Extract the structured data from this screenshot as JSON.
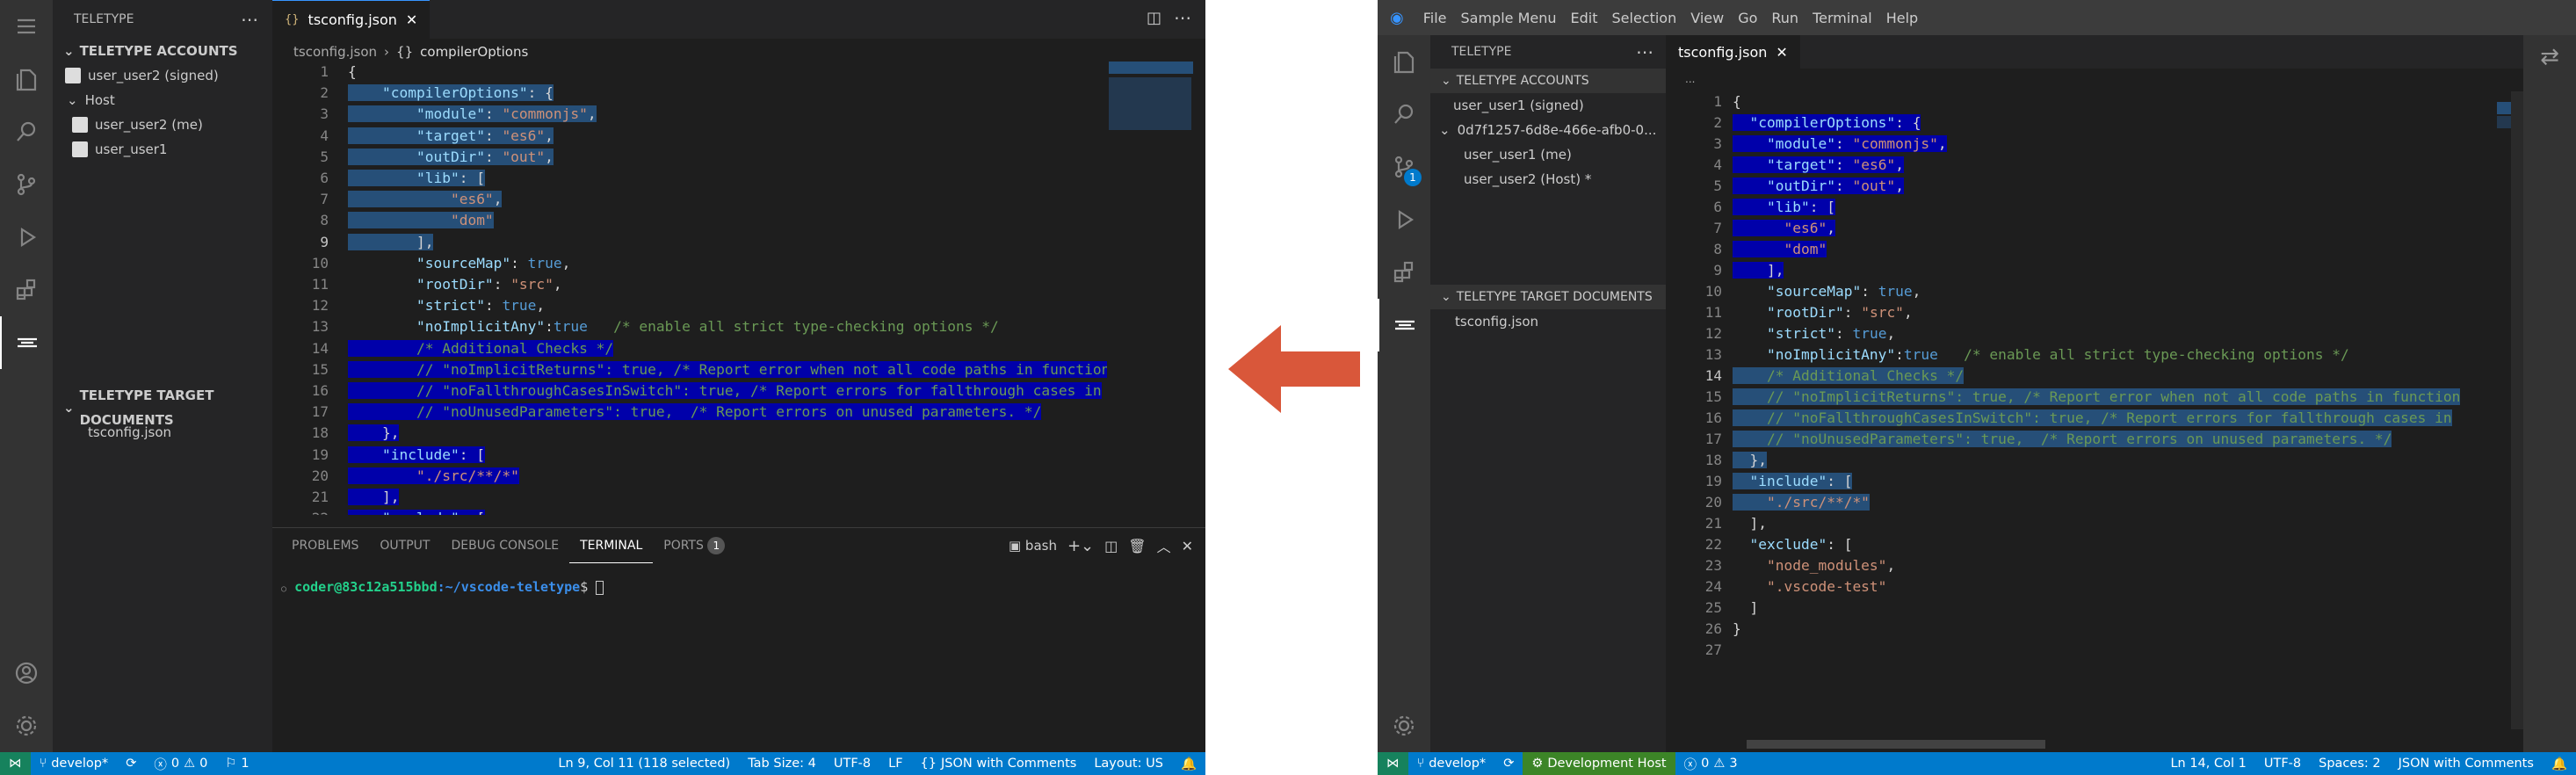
{
  "left": {
    "sidebar": {
      "title": "TELETYPE",
      "accounts_header": "TELETYPE ACCOUNTS",
      "signed_user": "user_user2 (signed)",
      "host_label": "Host",
      "users": [
        "user_user2 (me)",
        "user_user1"
      ],
      "docs_header": "TELETYPE TARGET DOCUMENTS",
      "doc": "tsconfig.json"
    },
    "tab": "tsconfig.json",
    "breadcrumb": {
      "file": "tsconfig.json",
      "node": "compilerOptions"
    },
    "panel": {
      "tabs": [
        "PROBLEMS",
        "OUTPUT",
        "DEBUG CONSOLE",
        "TERMINAL",
        "PORTS"
      ],
      "ports_count": "1",
      "shell": "bash",
      "prompt_user": "coder@83c12a515bbd",
      "prompt_path": ":~/vscode-teletype",
      "prompt_end": "$"
    },
    "status": {
      "branch": "develop*",
      "errors": "0",
      "warnings": "0",
      "remote": "1",
      "cursor": "Ln 9, Col 11 (118 selected)",
      "tab_size": "Tab Size: 4",
      "encoding": "UTF-8",
      "eol": "LF",
      "lang": "JSON with Comments",
      "layout": "Layout: US"
    }
  },
  "right": {
    "menu": [
      "File",
      "Sample Menu",
      "Edit",
      "Selection",
      "View",
      "Go",
      "Run",
      "Terminal",
      "Help"
    ],
    "sidebar": {
      "title": "TELETYPE",
      "accounts_header": "TELETYPE ACCOUNTS",
      "signed_user": "user_user1 (signed)",
      "session": "0d7f1257-6d8e-466e-afb0-0...",
      "users": [
        "user_user1 (me)",
        "user_user2 (Host) *"
      ],
      "docs_header": "TELETYPE TARGET DOCUMENTS",
      "doc": "tsconfig.json"
    },
    "scm_badge": "1",
    "tab": "tsconfig.json",
    "breadcrumb": "...",
    "status": {
      "branch": "develop*",
      "dev_host": "Development Host",
      "errors": "0",
      "warnings": "3",
      "cursor": "Ln 14, Col 1",
      "encoding": "UTF-8",
      "spaces": "Spaces: 2",
      "lang": "JSON with Comments"
    }
  },
  "code_lines": [
    "{",
    "  \"compilerOptions\": {",
    "    \"module\": \"commonjs\",",
    "    \"target\": \"es6\",",
    "    \"outDir\": \"out\",",
    "    \"lib\": [",
    "      \"es6\",",
    "      \"dom\"",
    "    ],",
    "    \"sourceMap\": true,",
    "    \"rootDir\": \"src\",",
    "    \"strict\": true,",
    "    \"noImplicitAny\":true   /* enable all strict type-checking options */",
    "    /* Additional Checks */",
    "    // \"noImplicitReturns\": true, /* Report error when not all code paths in function",
    "    // \"noFallthroughCasesInSwitch\": true, /* Report errors for fallthrough cases in",
    "    // \"noUnusedParameters\": true,  /* Report errors on unused parameters. */",
    "  },",
    "  \"include\": [",
    "    \"./src/**/*\"",
    "  ],",
    "  \"exclude\": [",
    "    \"node_modules\",",
    "    \".vscode-test\"",
    "  ]",
    "}",
    ""
  ]
}
